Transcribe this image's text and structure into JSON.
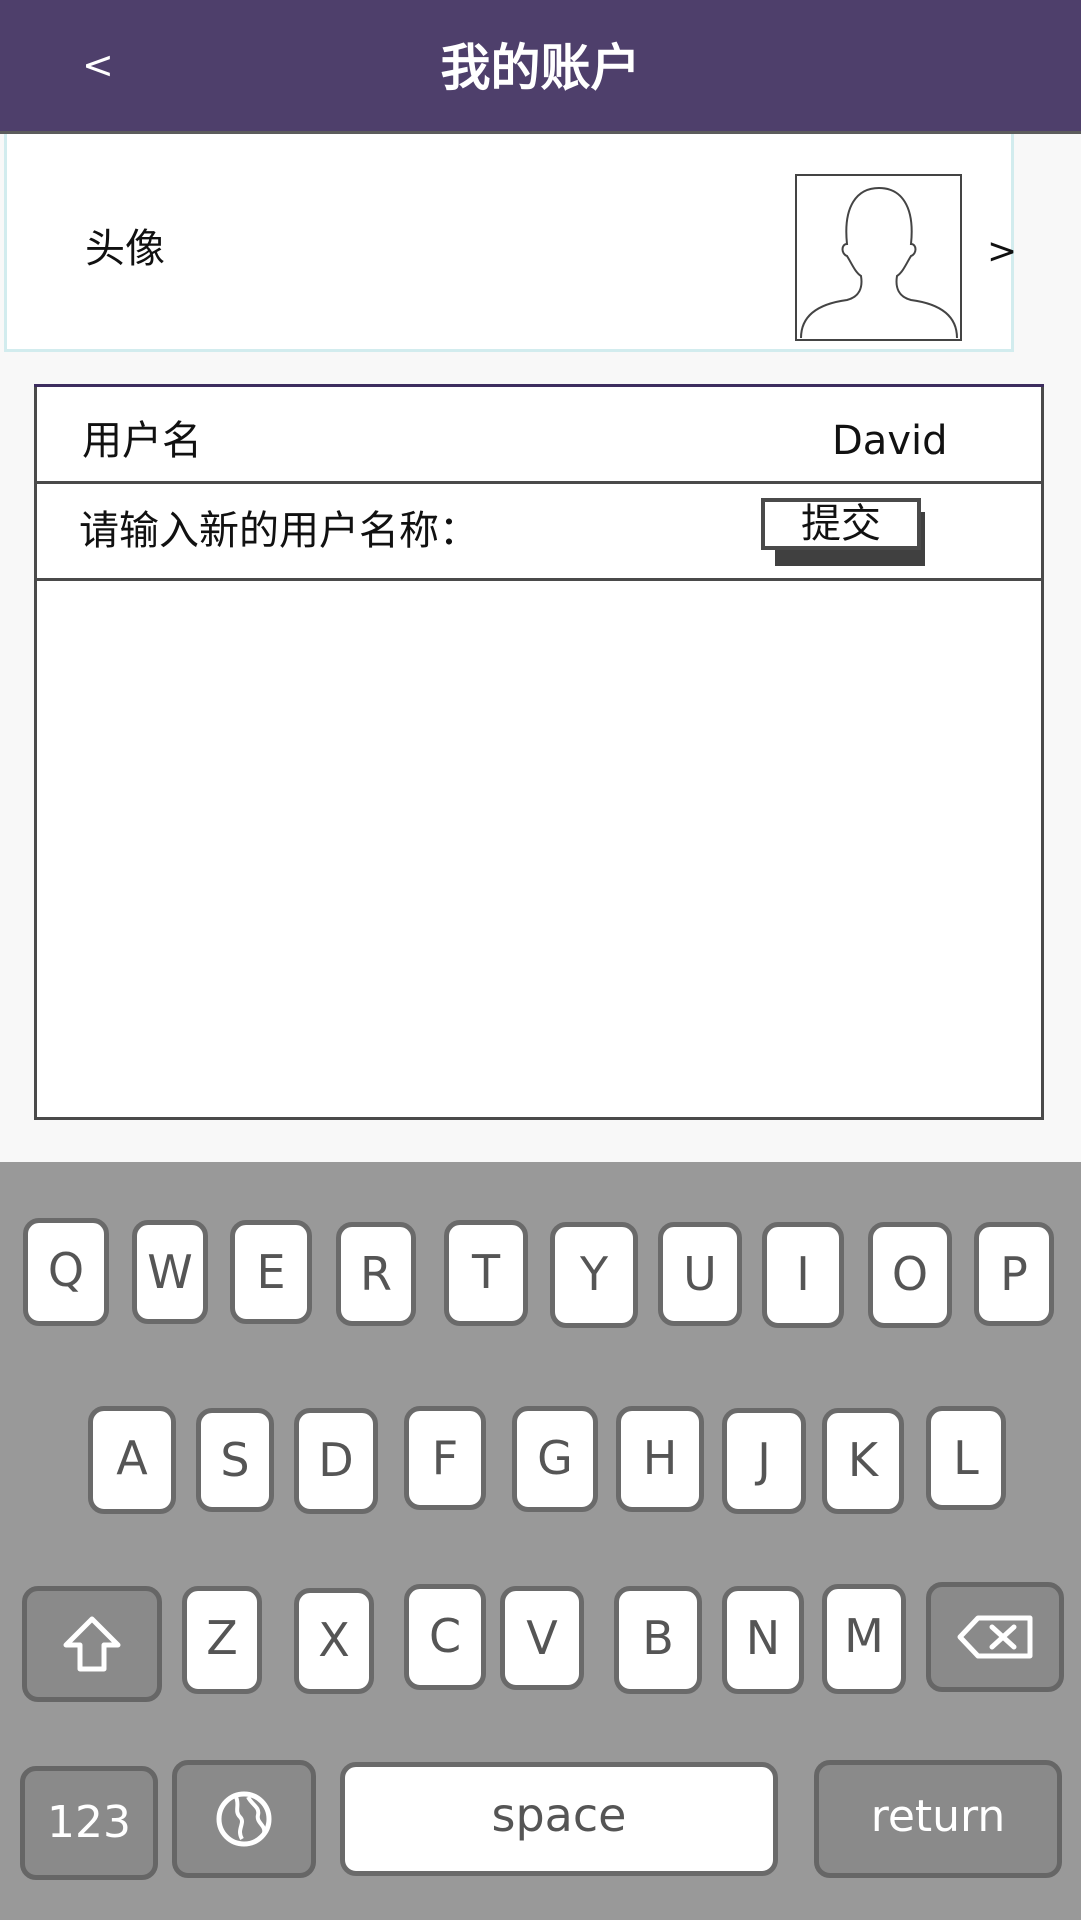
{
  "header": {
    "back_label": "<",
    "title": "我的账户"
  },
  "avatar_row": {
    "label": "头像",
    "chevron": ">",
    "icon": "person-silhouette-icon"
  },
  "username_row": {
    "label": "用户名",
    "value": "David"
  },
  "rename_row": {
    "prompt": "请输入新的用户名称：",
    "submit_label": "提交"
  },
  "keyboard": {
    "row1": [
      "Q",
      "W",
      "E",
      "R",
      "T",
      "Y",
      "U",
      "I",
      "O",
      "P"
    ],
    "row2": [
      "A",
      "S",
      "D",
      "F",
      "G",
      "H",
      "J",
      "K",
      "L"
    ],
    "row3": [
      "Z",
      "X",
      "C",
      "V",
      "B",
      "N",
      "M"
    ],
    "shift_icon": "shift-arrow-icon",
    "backspace_icon": "backspace-icon",
    "numbers_label": "123",
    "globe_icon": "globe-icon",
    "space_label": "space",
    "return_label": "return"
  },
  "colors": {
    "header_bg": "#4e3f6b",
    "keyboard_bg": "#999999",
    "key_border": "#6a6a6a"
  }
}
